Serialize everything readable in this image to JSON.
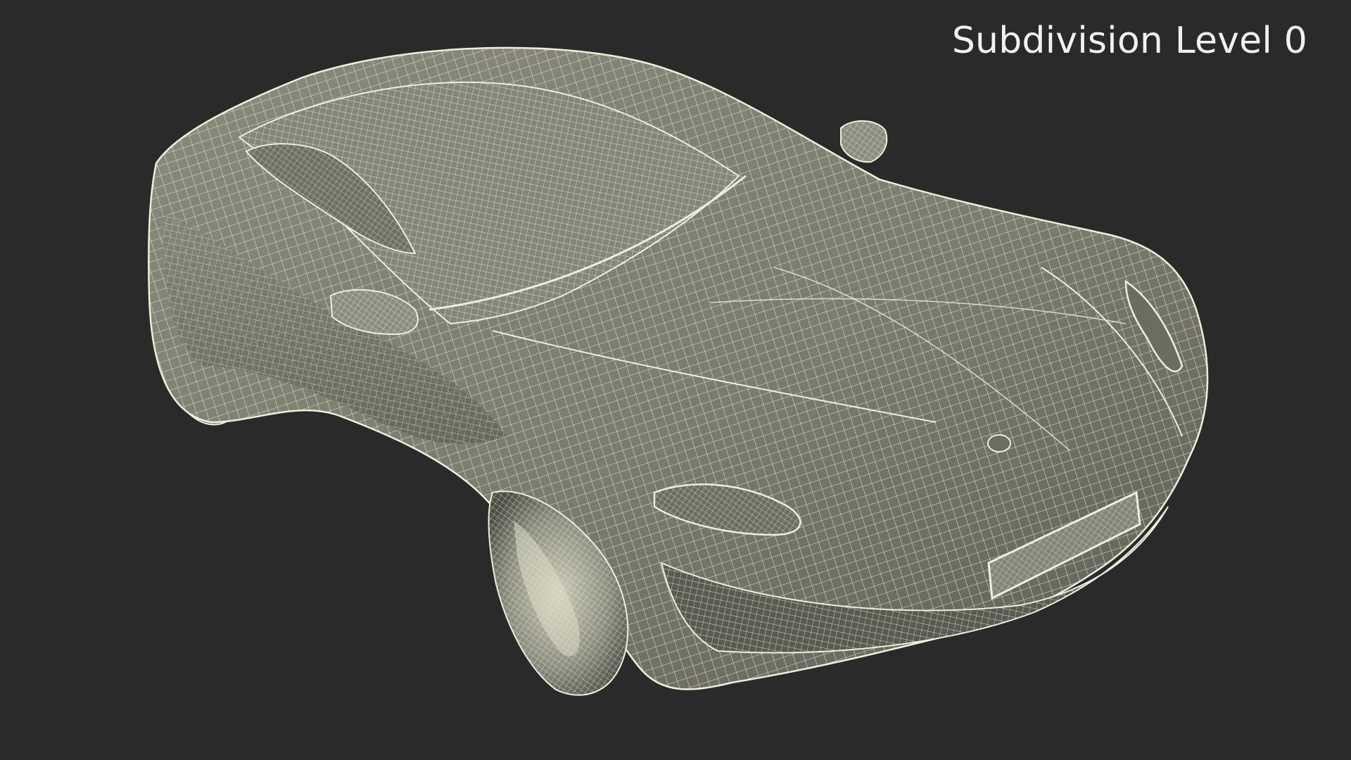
{
  "viewport": {
    "background_color": "#2a2a2a",
    "overlay_label": "Subdivision Level 0"
  },
  "render": {
    "subject": "wireframe car",
    "body_color": "#7d7d70",
    "wire_color": "#eeeedd",
    "shadow_color": "#4a4a42"
  }
}
